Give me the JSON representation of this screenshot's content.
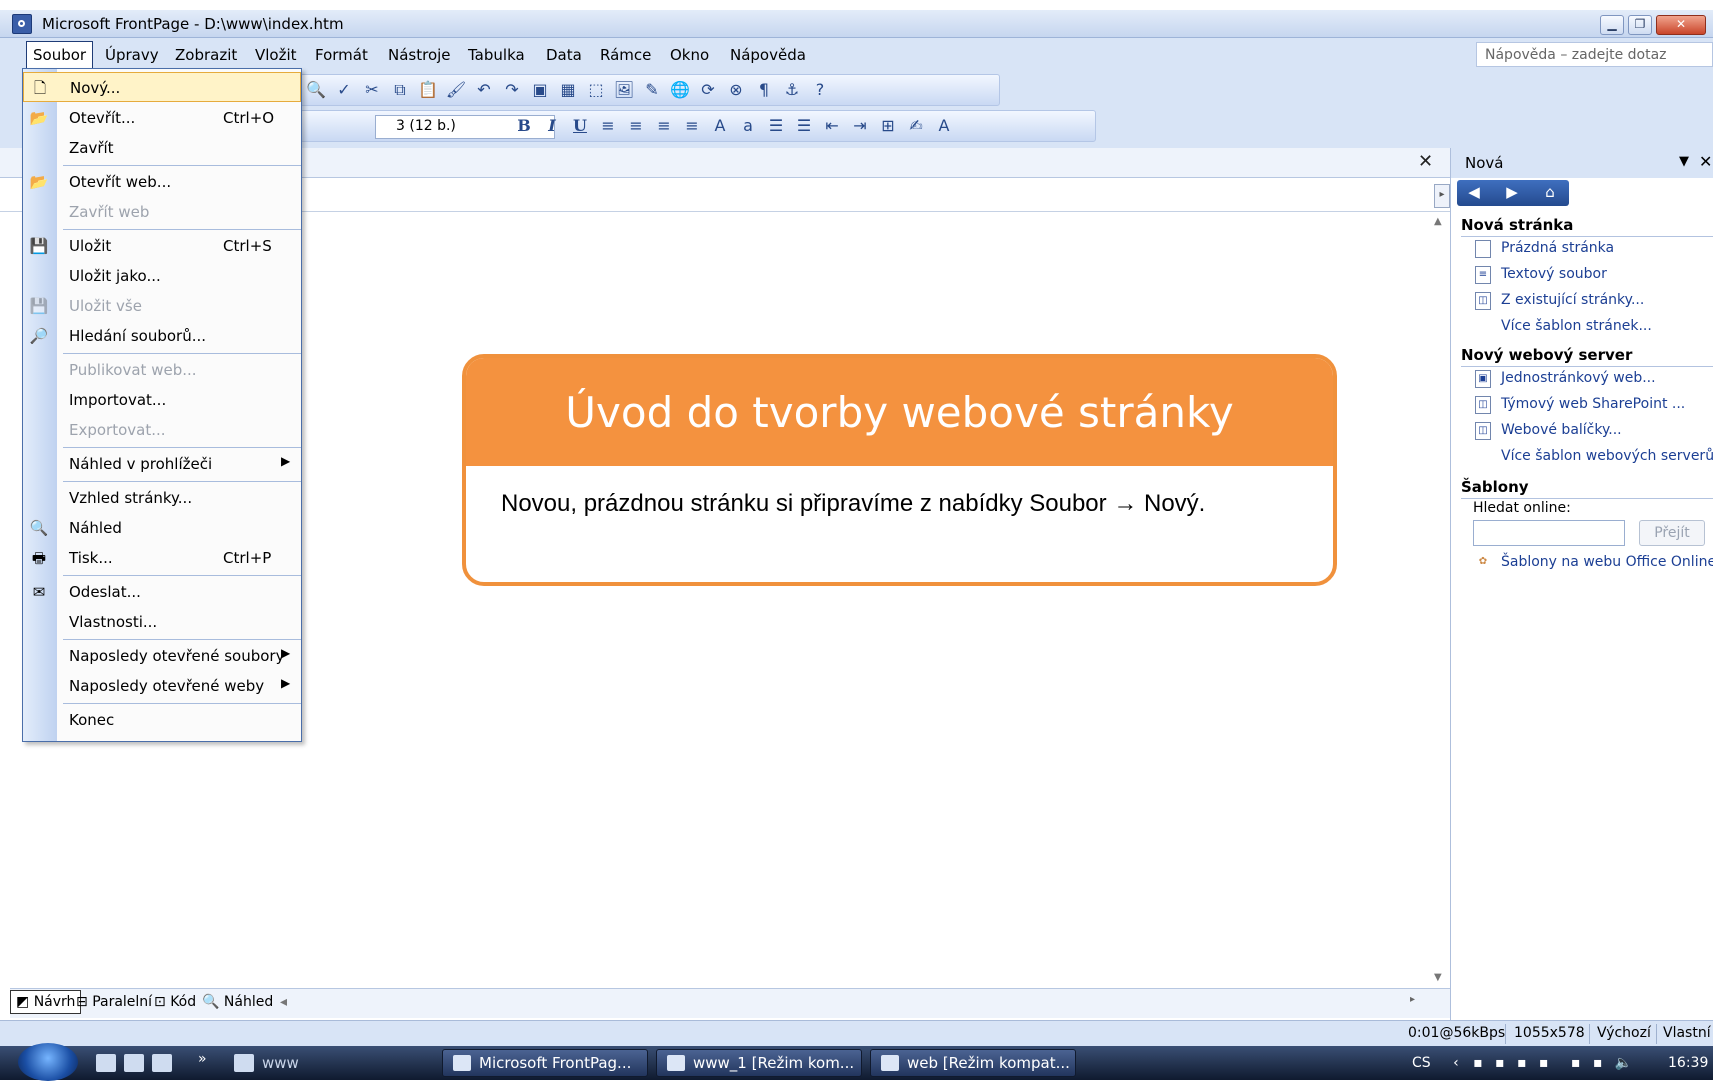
{
  "window": {
    "title": "Microsoft FrontPage - D:\\www\\index.htm"
  },
  "menubar": {
    "items": [
      "Soubor",
      "Úpravy",
      "Zobrazit",
      "Vložit",
      "Formát",
      "Nástroje",
      "Tabulka",
      "Data",
      "Rámce",
      "Okno",
      "Nápověda"
    ],
    "help_placeholder": "Nápověda – zadejte dotaz"
  },
  "toolbar": {
    "font_size": "3 (12 b.)",
    "bold": "B",
    "italic": "I",
    "underline": "U"
  },
  "file_menu": {
    "items": [
      {
        "label": "Nový...",
        "shortcut": ""
      },
      {
        "label": "Otevřít...",
        "shortcut": "Ctrl+O"
      },
      {
        "label": "Zavřít",
        "shortcut": ""
      },
      {
        "label": "Otevřít web...",
        "shortcut": ""
      },
      {
        "label": "Zavřít web",
        "shortcut": ""
      },
      {
        "label": "Uložit",
        "shortcut": "Ctrl+S"
      },
      {
        "label": "Uložit jako...",
        "shortcut": ""
      },
      {
        "label": "Uložit vše",
        "shortcut": ""
      },
      {
        "label": "Hledání souborů...",
        "shortcut": ""
      },
      {
        "label": "Publikovat web...",
        "shortcut": ""
      },
      {
        "label": "Importovat...",
        "shortcut": ""
      },
      {
        "label": "Exportovat...",
        "shortcut": ""
      },
      {
        "label": "Náhled v prohlížeči",
        "shortcut": ""
      },
      {
        "label": "Vzhled stránky...",
        "shortcut": ""
      },
      {
        "label": "Náhled",
        "shortcut": ""
      },
      {
        "label": "Tisk...",
        "shortcut": "Ctrl+P"
      },
      {
        "label": "Odeslat...",
        "shortcut": ""
      },
      {
        "label": "Vlastnosti...",
        "shortcut": ""
      },
      {
        "label": "Naposledy otevřené soubory",
        "shortcut": ""
      },
      {
        "label": "Naposledy otevřené weby",
        "shortcut": ""
      },
      {
        "label": "Konec",
        "shortcut": ""
      }
    ]
  },
  "callout": {
    "title": "Úvod do tvorby webové stránky",
    "text": "Novou, prázdnou stránku si připravíme z nabídky Soubor → Nový."
  },
  "view_tabs": [
    "Návrh",
    "Paralelní",
    "Kód",
    "Náhled"
  ],
  "status": {
    "speed": "0:01@56kBps",
    "size": "1055x578",
    "style": "Výchozí",
    "custom": "Vlastní"
  },
  "taskpane": {
    "title": "Nová",
    "section_page": "Nová stránka",
    "page_links": [
      "Prázdná stránka",
      "Textový soubor",
      "Z existující stránky...",
      "Více šablon stránek..."
    ],
    "section_server": "Nový webový server",
    "server_links": [
      "Jednostránkový web...",
      "Týmový web SharePoint ...",
      "Webové balíčky...",
      "Více šablon webových serverů..."
    ],
    "section_templates": "Šablony",
    "search_label": "Hledat online:",
    "go_button": "Přejít",
    "online_link": "Šablony na webu Office Online"
  },
  "taskbar": {
    "quick_label": "www",
    "buttons": [
      "Microsoft FrontPag...",
      "www_1 [Režim kom...",
      "web [Režim kompat..."
    ],
    "lang": "CS",
    "clock": "16:39"
  }
}
